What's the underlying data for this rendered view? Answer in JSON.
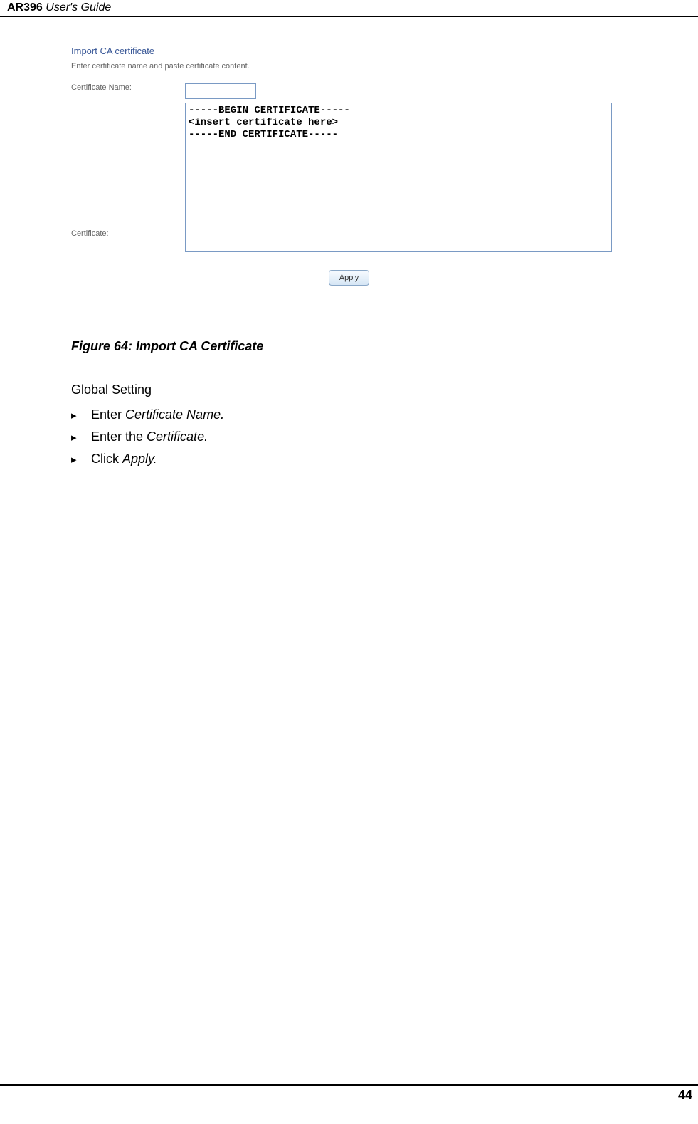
{
  "header": {
    "product": "AR396",
    "suffix": " User's Guide"
  },
  "form": {
    "title": "Import CA certificate",
    "subtitle": "Enter certificate name and paste certificate content.",
    "certNameLabel": "Certificate Name:",
    "certLabel": "Certificate:",
    "certContent": "-----BEGIN CERTIFICATE-----\n<insert certificate here>\n-----END CERTIFICATE-----",
    "applyLabel": "Apply"
  },
  "figureCaption": "Figure 64: Import CA Certificate",
  "sectionHeading": "Global Setting",
  "bullets": [
    {
      "prefix": "Enter ",
      "italic": "Certificate Name."
    },
    {
      "prefix": "Enter the ",
      "italic": "Certificate."
    },
    {
      "prefix": "Click ",
      "italic": "Apply."
    }
  ],
  "pageNumber": "44"
}
